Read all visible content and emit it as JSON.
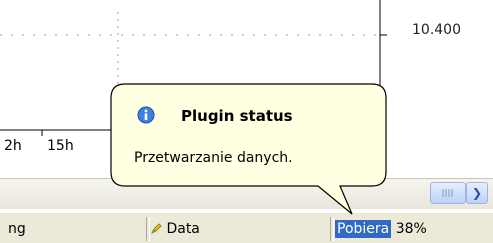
{
  "chart": {
    "price_label": "10.400",
    "time_labels": [
      "2h",
      "15h"
    ]
  },
  "status_bar": {
    "panel_1": "ng",
    "panel_2": "Data",
    "panel_3_highlight": "Pobiera",
    "panel_3_value": "38%"
  },
  "balloon": {
    "title": "Plugin status",
    "message": "Przetwarzanie danych.",
    "icon": "info-icon",
    "background_color": "#ffffe1"
  },
  "colors": {
    "highlight": "#316ac5",
    "status_bar_bg": "#ece9d8"
  }
}
